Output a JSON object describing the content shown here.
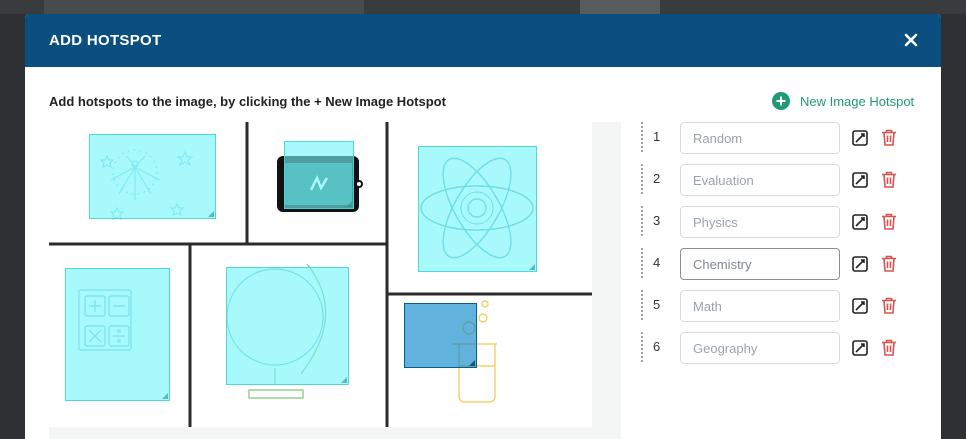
{
  "modal": {
    "title": "ADD HOTSPOT",
    "close_icon": "close-icon"
  },
  "instructions": "Add hotspots to the image, by clicking the + New Image Hotspot",
  "new_hotspot_label": "New Image Hotspot",
  "colors": {
    "header": "#0b4f80",
    "accent": "#1f9a74",
    "hotspot_fill": "#73f5fa",
    "hotspot_selected": "#0082c8",
    "delete": "#d9534f"
  },
  "hotspots": [
    {
      "number": "1",
      "placeholder": "Random"
    },
    {
      "number": "2",
      "placeholder": "Evaluation"
    },
    {
      "number": "3",
      "placeholder": "Physics"
    },
    {
      "number": "4",
      "placeholder": "Chemistry",
      "active": true
    },
    {
      "number": "5",
      "placeholder": "Math"
    },
    {
      "number": "6",
      "placeholder": "Geography"
    }
  ]
}
